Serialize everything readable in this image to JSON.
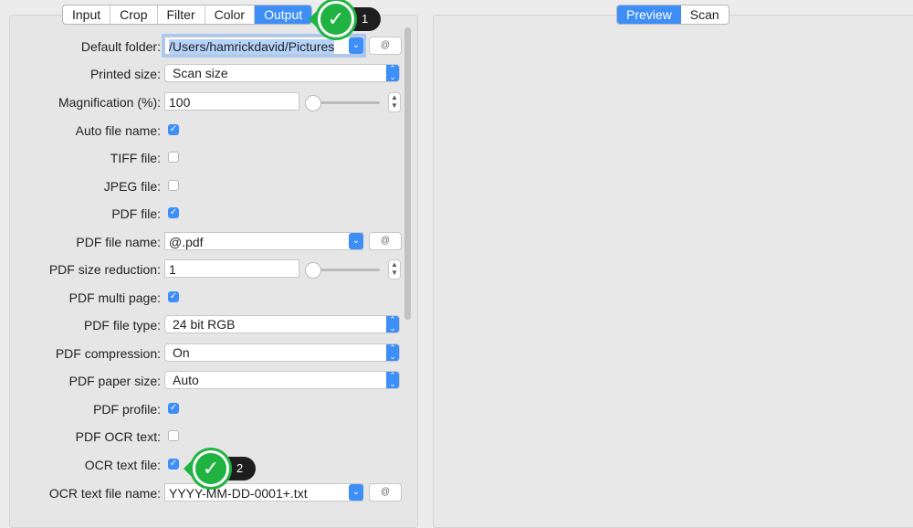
{
  "tabs": [
    "Input",
    "Crop",
    "Filter",
    "Color",
    "Output"
  ],
  "active_tab": "Output",
  "right_tabs": [
    "Preview",
    "Scan"
  ],
  "active_right_tab": "Preview",
  "rows": {
    "default_folder": {
      "label": "Default folder:",
      "value": "/Users/hamrickdavid/Pictures",
      "button": "@"
    },
    "printed_size": {
      "label": "Printed size:",
      "value": "Scan size"
    },
    "magnification": {
      "label": "Magnification (%):",
      "value": "100"
    },
    "auto_file_name": {
      "label": "Auto file name:",
      "checked": true
    },
    "tiff_file": {
      "label": "TIFF file:",
      "checked": false
    },
    "jpeg_file": {
      "label": "JPEG file:",
      "checked": false
    },
    "pdf_file": {
      "label": "PDF file:",
      "checked": true
    },
    "pdf_file_name": {
      "label": "PDF file name:",
      "value": "@.pdf",
      "button": "@"
    },
    "pdf_size_reduction": {
      "label": "PDF size reduction:",
      "value": "1"
    },
    "pdf_multi_page": {
      "label": "PDF multi page:",
      "checked": true
    },
    "pdf_file_type": {
      "label": "PDF file type:",
      "value": "24 bit RGB"
    },
    "pdf_compression": {
      "label": "PDF compression:",
      "value": "On"
    },
    "pdf_paper_size": {
      "label": "PDF paper size:",
      "value": "Auto"
    },
    "pdf_profile": {
      "label": "PDF profile:",
      "checked": true
    },
    "pdf_ocr_text": {
      "label": "PDF OCR text:",
      "checked": false
    },
    "ocr_text_file": {
      "label": "OCR text file:",
      "checked": true
    },
    "ocr_text_file_name": {
      "label": "OCR text file name:",
      "value": "YYYY-MM-DD-0001+.txt",
      "button": "@"
    }
  },
  "annotations": [
    "1",
    "2"
  ],
  "colors": {
    "accent": "#3d8ef7",
    "badge_green": "#21b342"
  }
}
